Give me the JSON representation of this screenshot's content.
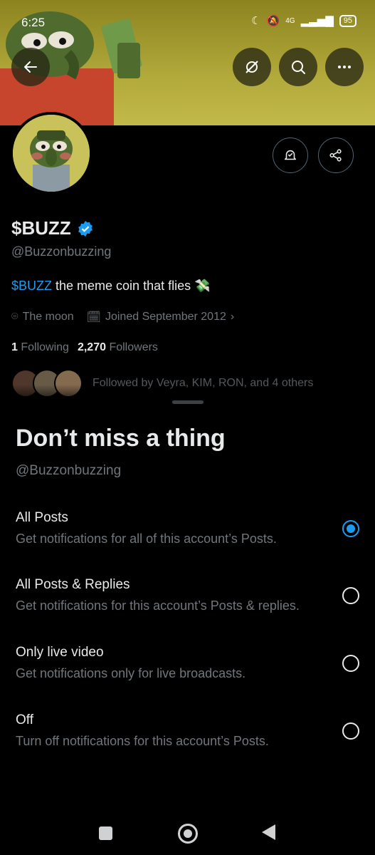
{
  "status_bar": {
    "time": "6:25",
    "network": "4G",
    "battery": "95"
  },
  "header": {
    "buttons": [
      "back-icon",
      "grok-icon",
      "search-icon",
      "more-icon"
    ]
  },
  "profile": {
    "name": "$BUZZ",
    "handle": "@Buzzonbuzzing",
    "bio_cashtag": "$BUZZ",
    "bio_text": " the meme coin that flies 💸",
    "location": "The moon",
    "joined": "Joined September 2012",
    "following_count": "1",
    "following_label": "Following",
    "followers_count": "2,270",
    "followers_label": "Followers",
    "followed_by": "Followed by Veyra, KIM, RON, and 4 others"
  },
  "sheet": {
    "title": "Don’t miss a thing",
    "handle": "@Buzzonbuzzing",
    "options": [
      {
        "title": "All Posts",
        "desc": "Get notifications for all of this account’s Posts.",
        "selected": true
      },
      {
        "title": "All Posts & Replies",
        "desc": "Get notifications for this account’s Posts & replies.",
        "selected": false
      },
      {
        "title": "Only live video",
        "desc": "Get notifications only for live broadcasts.",
        "selected": false
      },
      {
        "title": "Off",
        "desc": "Turn off notifications for this account’s Posts.",
        "selected": false
      }
    ]
  },
  "colors": {
    "accent": "#1d9bf0",
    "muted": "#71767b",
    "text": "#e7e9ea",
    "background": "#000000"
  }
}
